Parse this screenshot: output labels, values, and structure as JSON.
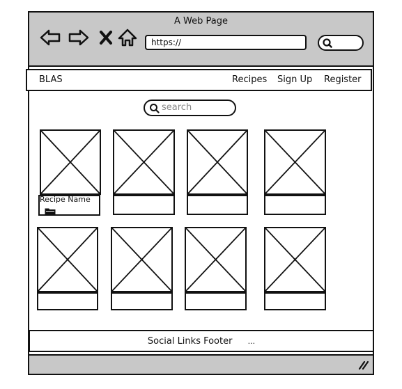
{
  "window": {
    "title": "A Web Page"
  },
  "toolbar": {
    "back_icon": "back-arrow-icon",
    "forward_icon": "forward-arrow-icon",
    "stop_icon": "close-icon",
    "home_icon": "home-icon",
    "url": "https://",
    "search_icon": "search-icon"
  },
  "nav": {
    "brand": "BLAS",
    "links": [
      "Recipes",
      "Sign Up",
      "Register"
    ]
  },
  "search": {
    "placeholder": "search"
  },
  "recipes": [
    {
      "name": "Recipe Name",
      "icon": "folder-icon"
    },
    {
      "name": ""
    },
    {
      "name": ""
    },
    {
      "name": ""
    },
    {
      "name": ""
    },
    {
      "name": ""
    },
    {
      "name": ""
    },
    {
      "name": ""
    }
  ],
  "footer": {
    "text": "Social Links Footer",
    "extra": "..."
  },
  "statusbar": {
    "resize_icon": "resize-grip-icon"
  }
}
